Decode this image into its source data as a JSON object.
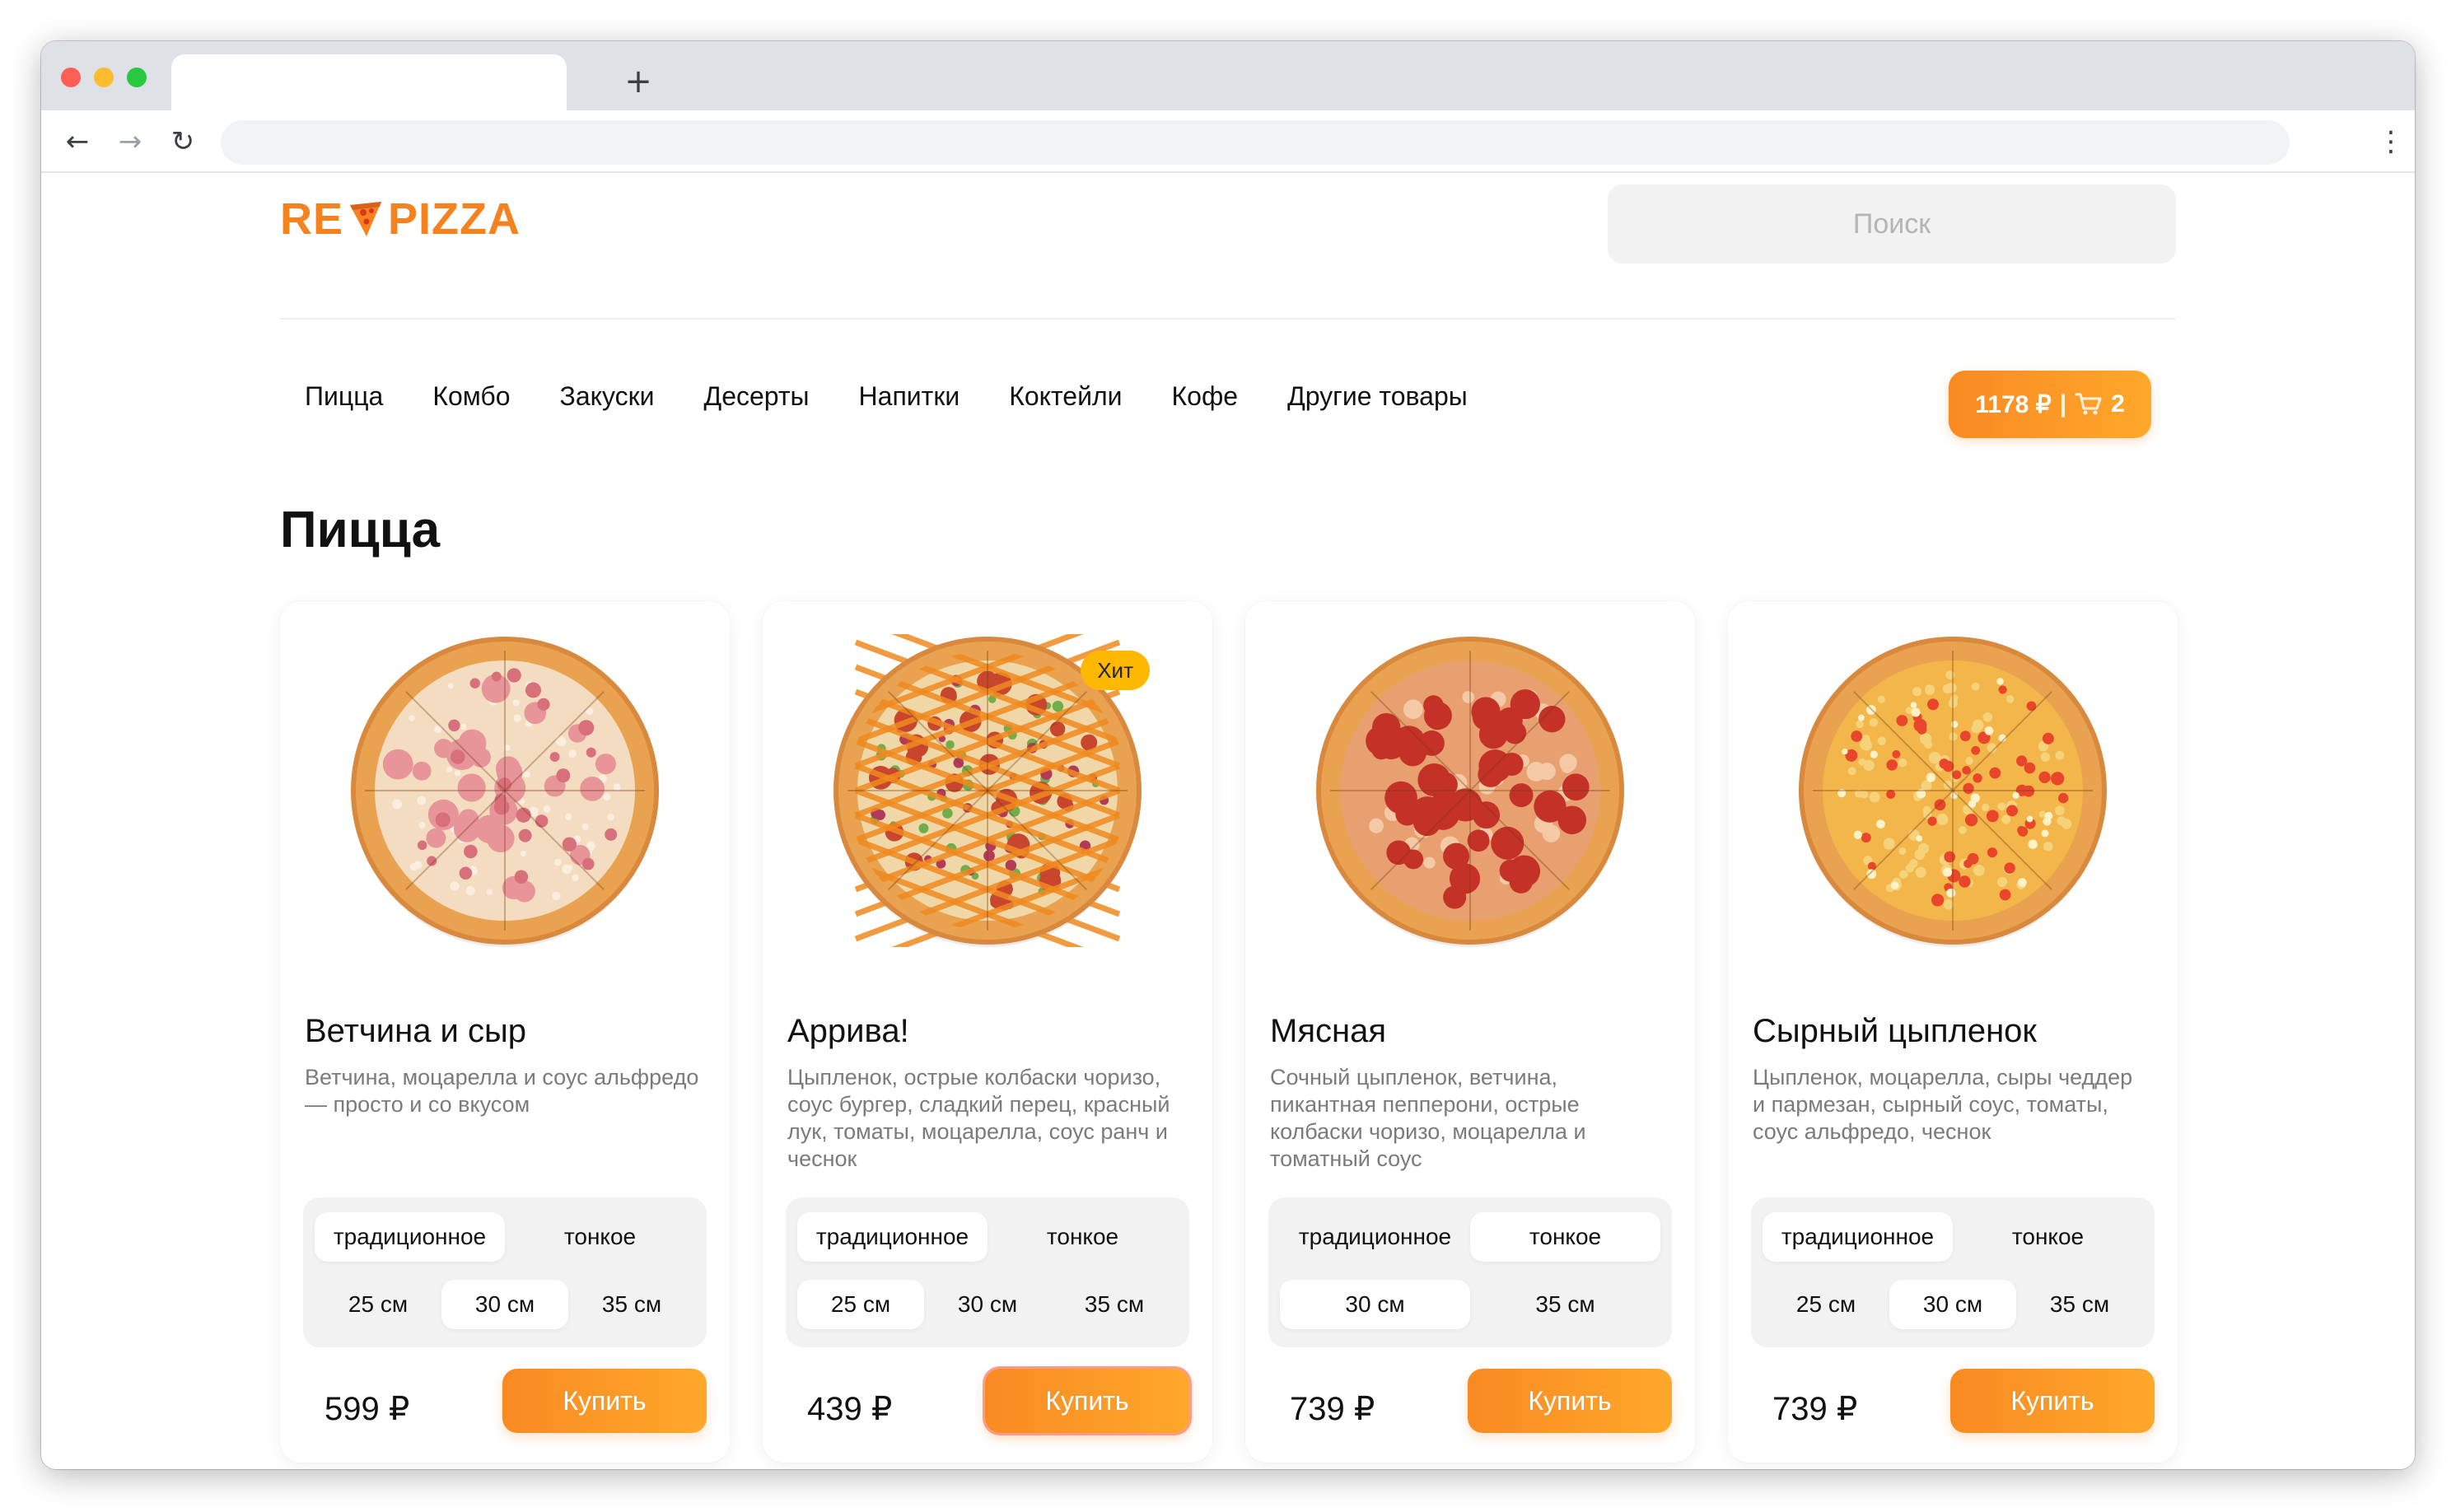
{
  "browser": {
    "tab_title": "",
    "new_tab_icon": "plus-icon",
    "url": ""
  },
  "header": {
    "logo_left": "RE",
    "logo_right": "PIZZA",
    "search_placeholder": "Поиск"
  },
  "categories": [
    "Пицца",
    "Комбо",
    "Закуски",
    "Десерты",
    "Напитки",
    "Коктейли",
    "Кофе",
    "Другие товары"
  ],
  "cart": {
    "total": "1178 ₽",
    "separator": "|",
    "icon": "cart-icon",
    "count": "2"
  },
  "section_title": "Пицца",
  "products": [
    {
      "name": "Ветчина и сыр",
      "description": "Ветчина, моцарелла и соус альфредо — просто и со вкусом",
      "badge": "",
      "dough": [
        "традиционное",
        "тонкое"
      ],
      "dough_selected": "традиционное",
      "sizes": [
        "25 см",
        "30 см",
        "35 см"
      ],
      "size_selected": "30 см",
      "price": "599 ₽",
      "buy_label": "Купить",
      "topping": "ham"
    },
    {
      "name": "Аррива!",
      "description": "Цыпленок, острые колбаски чоризо, соус бургер, сладкий перец, красный лук, томаты, моцарелла, соус ранч и чеснок",
      "badge": "Хит",
      "dough": [
        "традиционное",
        "тонкое"
      ],
      "dough_selected": "традиционное",
      "sizes": [
        "25 см",
        "30 см",
        "35 см"
      ],
      "size_selected": "25 см",
      "price": "439 ₽",
      "buy_label": "Купить",
      "topping": "arriva"
    },
    {
      "name": "Мясная",
      "description": "Сочный цыпленок, ветчина, пикантная пепперони, острые колбаски чоризо, моцарелла и томатный соус",
      "badge": "",
      "dough": [
        "традиционное",
        "тонкое"
      ],
      "dough_selected": "тонкое",
      "sizes": [
        "30 см",
        "35 см"
      ],
      "size_selected": "30 см",
      "price": "739 ₽",
      "buy_label": "Купить",
      "topping": "pepperoni"
    },
    {
      "name": "Сырный цыпленок",
      "description": "Цыпленок, моцарелла, сыры чеддер и пармезан, сырный соус, томаты, соус альфредо, чеснок",
      "badge": "",
      "dough": [
        "традиционное",
        "тонкое"
      ],
      "dough_selected": "традиционное",
      "sizes": [
        "25 см",
        "30 см",
        "35 см"
      ],
      "size_selected": "30 см",
      "price": "739 ₽",
      "buy_label": "Купить",
      "topping": "cheese-chicken"
    }
  ],
  "colors": {
    "brand": "#f6821f",
    "button_start": "#f98a23",
    "button_end": "#ffa82a",
    "badge": "#ffb800"
  }
}
